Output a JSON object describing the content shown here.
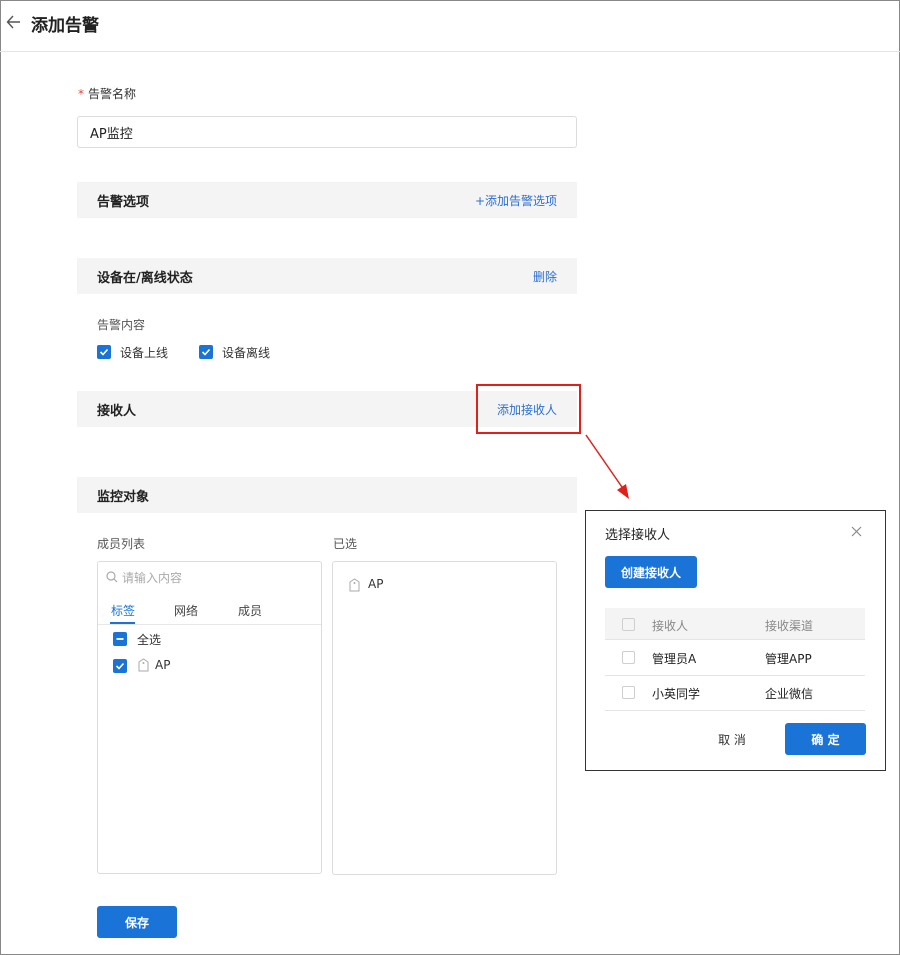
{
  "header": {
    "title": "添加告警",
    "back_icon": "arrow-left-icon"
  },
  "form": {
    "name_label": "告警名称",
    "name_value": "AP监控",
    "alert_options": {
      "title": "告警选项",
      "link": "+添加告警选项"
    },
    "device_status": {
      "title": "设备在/离线状态",
      "link": "删除",
      "content_label": "告警内容",
      "options": [
        {
          "label": "设备上线",
          "checked": true
        },
        {
          "label": "设备离线",
          "checked": true
        }
      ]
    },
    "receivers": {
      "title": "接收人",
      "link": "添加接收人"
    },
    "monitor": {
      "title": "监控对象",
      "members_label": "成员列表",
      "selected_label": "已选",
      "search_placeholder": "请输入内容",
      "tabs": [
        "标签",
        "网络",
        "成员"
      ],
      "active_tab": "标签",
      "select_all": "全选",
      "items": [
        "AP"
      ],
      "selected_items": [
        "AP"
      ]
    },
    "save_label": "保存"
  },
  "dialog": {
    "title": "选择接收人",
    "create_label": "创建接收人",
    "columns": [
      "接收人",
      "接收渠道"
    ],
    "rows": [
      {
        "receiver": "管理员A",
        "channel": "管理APP"
      },
      {
        "receiver": "小英同学",
        "channel": "企业微信"
      }
    ],
    "cancel_label": "取 消",
    "ok_label": "确 定"
  },
  "colors": {
    "accent": "#1a73d6",
    "highlight": "#e0201b",
    "required": "#e8433a"
  }
}
